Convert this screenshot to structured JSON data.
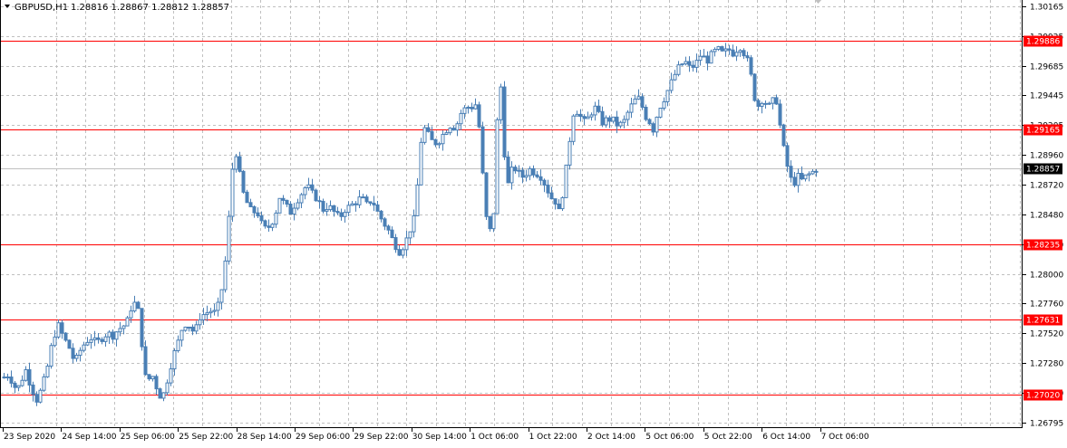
{
  "header": {
    "symbol_timeframe": "GBPUSD,H1",
    "ohlc": "1.28816 1.28867 1.28812 1.28857",
    "menu_icon": "triangle-down-icon"
  },
  "chart_data": {
    "type": "candlestick",
    "symbol": "GBPUSD",
    "timeframe": "H1",
    "last_ohlc": {
      "open": 1.28816,
      "high": 1.28867,
      "low": 1.28812,
      "close": 1.28857
    },
    "current_price": "1.28857",
    "ylim": [
      1.26795,
      1.30165
    ],
    "y_ticks": [
      "1.30165",
      "1.29925",
      "1.29685",
      "1.29445",
      "1.29205",
      "1.28960",
      "1.28720",
      "1.28480",
      "1.28240",
      "1.28000",
      "1.27760",
      "1.27520",
      "1.27280",
      "1.27040",
      "1.26795"
    ],
    "x_ticks": [
      "23 Sep 2020",
      "24 Sep 14:00",
      "25 Sep 06:00",
      "25 Sep 22:00",
      "28 Sep 14:00",
      "29 Sep 06:00",
      "29 Sep 22:00",
      "30 Sep 14:00",
      "1 Oct 06:00",
      "1 Oct 22:00",
      "2 Oct 14:00",
      "5 Oct 06:00",
      "5 Oct 22:00",
      "6 Oct 14:00",
      "7 Oct 06:00"
    ],
    "horizontal_levels": [
      {
        "value": 1.29886,
        "label": "1.29886",
        "color": "#ff0000"
      },
      {
        "value": 1.29165,
        "label": "1.29165",
        "color": "#ff0000"
      },
      {
        "value": 1.28235,
        "label": "1.28235",
        "color": "#ff0000"
      },
      {
        "value": 1.27631,
        "label": "1.27631",
        "color": "#ff0000"
      },
      {
        "value": 1.2702,
        "label": "1.27020",
        "color": "#ff0000"
      }
    ],
    "grid": true,
    "colors": {
      "candles": "#4a7fb5",
      "levels": "#ff0000",
      "grid": "#c0c0c0",
      "current_tag": "#000000"
    },
    "path_points": [
      [
        0,
        1.2715
      ],
      [
        8,
        1.2718
      ],
      [
        14,
        1.2712
      ],
      [
        18,
        1.2705
      ],
      [
        22,
        1.2712
      ],
      [
        28,
        1.2722
      ],
      [
        34,
        1.2708
      ],
      [
        40,
        1.2698
      ],
      [
        46,
        1.2708
      ],
      [
        52,
        1.2725
      ],
      [
        58,
        1.2748
      ],
      [
        64,
        1.2758
      ],
      [
        70,
        1.2748
      ],
      [
        76,
        1.274
      ],
      [
        82,
        1.2728
      ],
      [
        88,
        1.2738
      ],
      [
        94,
        1.2745
      ],
      [
        100,
        1.2748
      ],
      [
        106,
        1.2744
      ],
      [
        112,
        1.2748
      ],
      [
        118,
        1.2752
      ],
      [
        124,
        1.275
      ],
      [
        130,
        1.2755
      ],
      [
        136,
        1.2758
      ],
      [
        140,
        1.2762
      ],
      [
        144,
        1.2772
      ],
      [
        150,
        1.2778
      ],
      [
        154,
        1.2762
      ],
      [
        158,
        1.2725
      ],
      [
        162,
        1.2708
      ],
      [
        166,
        1.2722
      ],
      [
        170,
        1.2712
      ],
      [
        174,
        1.2705
      ],
      [
        178,
        1.2698
      ],
      [
        182,
        1.2708
      ],
      [
        186,
        1.272
      ],
      [
        190,
        1.2732
      ],
      [
        196,
        1.2745
      ],
      [
        202,
        1.276
      ],
      [
        208,
        1.2758
      ],
      [
        214,
        1.2752
      ],
      [
        220,
        1.2765
      ],
      [
        226,
        1.2768
      ],
      [
        232,
        1.277
      ],
      [
        238,
        1.2768
      ],
      [
        242,
        1.278
      ],
      [
        246,
        1.2795
      ],
      [
        250,
        1.2825
      ],
      [
        254,
        1.2865
      ],
      [
        258,
        1.2905
      ],
      [
        262,
        1.289
      ],
      [
        266,
        1.287
      ],
      [
        270,
        1.286
      ],
      [
        274,
        1.2855
      ],
      [
        278,
        1.2848
      ],
      [
        282,
        1.2852
      ],
      [
        286,
        1.2845
      ],
      [
        290,
        1.2836
      ],
      [
        296,
        1.2838
      ],
      [
        302,
        1.2845
      ],
      [
        308,
        1.2862
      ],
      [
        314,
        1.2856
      ],
      [
        320,
        1.285
      ],
      [
        326,
        1.2858
      ],
      [
        332,
        1.2865
      ],
      [
        338,
        1.2872
      ],
      [
        344,
        1.2865
      ],
      [
        350,
        1.286
      ],
      [
        356,
        1.2852
      ],
      [
        362,
        1.2855
      ],
      [
        368,
        1.285
      ],
      [
        374,
        1.2845
      ],
      [
        380,
        1.2852
      ],
      [
        386,
        1.2855
      ],
      [
        392,
        1.2858
      ],
      [
        398,
        1.2862
      ],
      [
        404,
        1.2856
      ],
      [
        410,
        1.286
      ],
      [
        416,
        1.285
      ],
      [
        422,
        1.2842
      ],
      [
        428,
        1.2835
      ],
      [
        434,
        1.2825
      ],
      [
        440,
        1.2818
      ],
      [
        446,
        1.2824
      ],
      [
        450,
        1.2832
      ],
      [
        454,
        1.284
      ],
      [
        458,
        1.2848
      ],
      [
        462,
        1.2895
      ],
      [
        466,
        1.292
      ],
      [
        470,
        1.2915
      ],
      [
        474,
        1.291
      ],
      [
        478,
        1.2905
      ],
      [
        484,
        1.2908
      ],
      [
        490,
        1.2915
      ],
      [
        496,
        1.292
      ],
      [
        502,
        1.2918
      ],
      [
        508,
        1.293
      ],
      [
        514,
        1.2935
      ],
      [
        520,
        1.2935
      ],
      [
        526,
        1.2938
      ],
      [
        530,
        1.29
      ],
      [
        534,
        1.286
      ],
      [
        538,
        1.283
      ],
      [
        542,
        1.284
      ],
      [
        546,
        1.286
      ],
      [
        549,
        1.2955
      ],
      [
        553,
        1.295
      ],
      [
        557,
        1.288
      ],
      [
        561,
        1.287
      ],
      [
        565,
        1.2888
      ],
      [
        571,
        1.2882
      ],
      [
        577,
        1.2878
      ],
      [
        583,
        1.2885
      ],
      [
        589,
        1.2882
      ],
      [
        595,
        1.288
      ],
      [
        601,
        1.2872
      ],
      [
        607,
        1.2862
      ],
      [
        613,
        1.2858
      ],
      [
        617,
        1.2848
      ],
      [
        621,
        1.287
      ],
      [
        625,
        1.289
      ],
      [
        629,
        1.2915
      ],
      [
        633,
        1.2935
      ],
      [
        639,
        1.2928
      ],
      [
        645,
        1.2922
      ],
      [
        651,
        1.293
      ],
      [
        657,
        1.2935
      ],
      [
        663,
        1.2922
      ],
      [
        669,
        1.2925
      ],
      [
        675,
        1.2925
      ],
      [
        681,
        1.292
      ],
      [
        687,
        1.2922
      ],
      [
        693,
        1.2932
      ],
      [
        699,
        1.294
      ],
      [
        705,
        1.2942
      ],
      [
        711,
        1.2928
      ],
      [
        717,
        1.2922
      ],
      [
        721,
        1.2915
      ],
      [
        725,
        1.2932
      ],
      [
        731,
        1.294
      ],
      [
        737,
        1.295
      ],
      [
        743,
        1.296
      ],
      [
        749,
        1.2968
      ],
      [
        755,
        1.2972
      ],
      [
        761,
        1.2966
      ],
      [
        767,
        1.297
      ],
      [
        773,
        1.2978
      ],
      [
        779,
        1.2972
      ],
      [
        785,
        1.2978
      ],
      [
        791,
        1.2982
      ],
      [
        797,
        1.2978
      ],
      [
        803,
        1.2982
      ],
      [
        809,
        1.2978
      ],
      [
        815,
        1.2985
      ],
      [
        819,
        1.298
      ],
      [
        823,
        1.2975
      ],
      [
        827,
        1.2965
      ],
      [
        831,
        1.2945
      ],
      [
        835,
        1.2935
      ],
      [
        841,
        1.2942
      ],
      [
        847,
        1.2935
      ],
      [
        851,
        1.2938
      ],
      [
        855,
        1.2945
      ],
      [
        859,
        1.2925
      ],
      [
        863,
        1.2905
      ],
      [
        867,
        1.289
      ],
      [
        871,
        1.2878
      ],
      [
        875,
        1.2872
      ],
      [
        879,
        1.288
      ],
      [
        883,
        1.2875
      ],
      [
        887,
        1.2878
      ],
      [
        891,
        1.288
      ],
      [
        895,
        1.2882
      ],
      [
        899,
        1.2884
      ],
      [
        903,
        1.2886
      ]
    ]
  }
}
